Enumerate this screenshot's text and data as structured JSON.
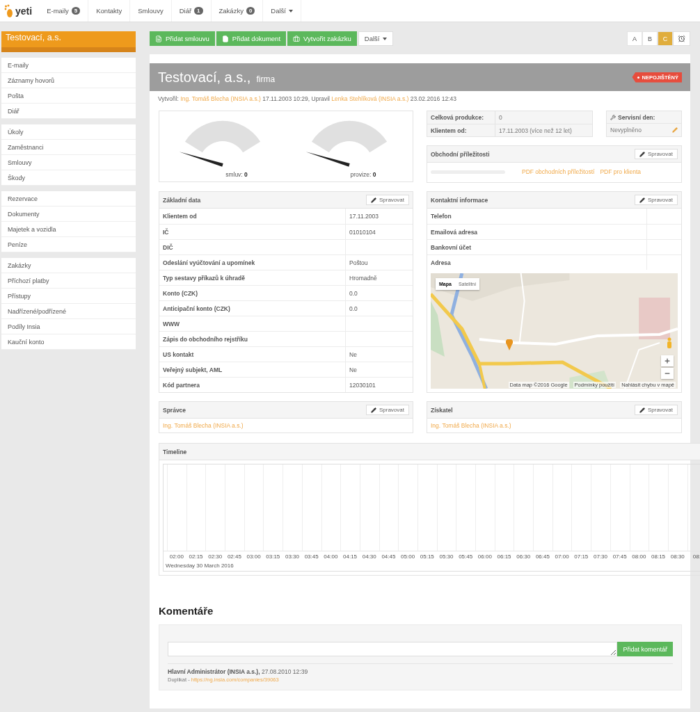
{
  "nav": {
    "logo": "yeti",
    "items": [
      {
        "label": "E-maily",
        "badge": "5"
      },
      {
        "label": "Kontakty"
      },
      {
        "label": "Smlouvy"
      },
      {
        "label": "Diář",
        "badge": "1"
      },
      {
        "label": "Zakázky",
        "badge": "0"
      }
    ],
    "more": "Další"
  },
  "sidebar": {
    "title": "Testovací, a.s.",
    "groups": [
      [
        "E-maily",
        "Záznamy hovorů",
        "Pošta",
        "Diář"
      ],
      [
        "Úkoly",
        "Zaměstnanci",
        "Smlouvy",
        "Škody"
      ],
      [
        "Rezervace",
        "Dokumenty",
        "Majetek a vozidla",
        "Peníze"
      ],
      [
        "Zakázky",
        "Příchozí platby",
        "Přístupy",
        "Nadřízené/podřízené",
        "Podíly Insia",
        "Kauční konto"
      ]
    ]
  },
  "toolbar": {
    "buttons": [
      {
        "label": "Přidat smlouvu",
        "kind": "contract"
      },
      {
        "label": "Přidat dokument",
        "kind": "document"
      },
      {
        "label": "Vytvořit zakázku",
        "kind": "briefcase"
      }
    ],
    "more": "Další",
    "variants": [
      {
        "label": "A",
        "selected": false
      },
      {
        "label": "B",
        "selected": false
      },
      {
        "label": "C",
        "selected": true
      }
    ]
  },
  "record": {
    "name": "Testovací, a.s.,",
    "type": "firma",
    "badge": "NEPOJIŠTĚNÝ",
    "meta": [
      {
        "text": "Vytvořil:",
        "kind": "text"
      },
      {
        "text": "Ing. Tomáš Blecha (INSIA a.s.)",
        "kind": "link"
      },
      {
        "text": "17.11.2003 10:29, Upravil",
        "kind": "text"
      },
      {
        "text": "Lenka Stehlíková (INSIA a.s.)",
        "kind": "link"
      },
      {
        "text": "23.02.2016 12:43",
        "kind": "text"
      }
    ]
  },
  "gauges": [
    {
      "label": "smluv:",
      "value": "0"
    },
    {
      "label": "provize:",
      "value": "0"
    }
  ],
  "stats": [
    {
      "label": "Celková produkce:",
      "value": "0"
    },
    {
      "label": "Klientem od:",
      "value": "17.11.2003",
      "note": "(více než 12 let)"
    }
  ],
  "service": {
    "title": "Servisní den:",
    "value": "Nevyplněno"
  },
  "opportunities": {
    "title": "Obchodní příležitosti",
    "action": "Spravovat",
    "links": [
      "PDF obchodních příležitostí",
      "PDF pro klienta"
    ]
  },
  "basic": {
    "title": "Základní data",
    "action": "Spravovat",
    "rows": [
      {
        "label": "Klientem od",
        "value": "17.11.2003"
      },
      {
        "label": "IČ",
        "value": "01010104"
      },
      {
        "label": "DIČ"
      },
      {
        "label": "Odeslání vyúčtování a upomínek",
        "value": "Poštou"
      },
      {
        "label": "Typ sestavy příkazů k úhradě",
        "value": "Hromadně"
      },
      {
        "label": "Konto (CZK)",
        "value": "0.0"
      },
      {
        "label": "Anticipační konto (CZK)",
        "value": "0.0"
      },
      {
        "label": "WWW"
      },
      {
        "label": "Zápis do obchodního rejstříku"
      },
      {
        "label": "US kontakt",
        "value": "Ne"
      },
      {
        "label": "Veřejný subjekt, AML",
        "value": "Ne"
      },
      {
        "label": "Kód partnera",
        "value": "12030101"
      }
    ]
  },
  "contact": {
    "title": "Kontaktní informace",
    "action": "Spravovat",
    "rows": [
      {
        "label": "Telefon"
      },
      {
        "label": "Emailová adresa"
      },
      {
        "label": "Bankovní účet"
      },
      {
        "label": "Adresa"
      }
    ],
    "map": {
      "tabs": [
        {
          "label": "Mapa",
          "selected": true
        },
        {
          "label": "Satelitní",
          "selected": false
        }
      ],
      "attribution": [
        "Data map ©2016 Google",
        "Podmínky použití",
        "Nahlásit chybu v mapě"
      ]
    }
  },
  "people": [
    {
      "title": "Správce",
      "action": "Spravovat",
      "person": "Ing. Tomáš Blecha (INSIA a.s.)"
    },
    {
      "title": "Získatel",
      "action": "Spravovat",
      "person": "Ing. Tomáš Blecha (INSIA a.s.)"
    }
  ],
  "timeline": {
    "title": "Timeline",
    "ticks": [
      "02:00",
      "02:15",
      "02:30",
      "02:45",
      "03:00",
      "03:15",
      "03:30",
      "03:45",
      "04:00",
      "04:15",
      "04:30",
      "04:45",
      "05:00",
      "05:15",
      "05:30",
      "05:45",
      "06:00",
      "06:15",
      "06:30",
      "06:45",
      "07:00",
      "07:15",
      "07:30",
      "07:45",
      "08:00",
      "08:15",
      "08:30",
      "08:"
    ],
    "date": "Wednesday 30 March 2016"
  },
  "comments": {
    "title": "Komentáře",
    "button": "Přidat komentář",
    "entries": [
      {
        "author": "Hlavní Administrátor (INSIA a.s.),",
        "date": "27.08.2010 12:39",
        "text": "Duplikat -",
        "link": "https://ng.insia.com/companies/39063"
      }
    ]
  }
}
